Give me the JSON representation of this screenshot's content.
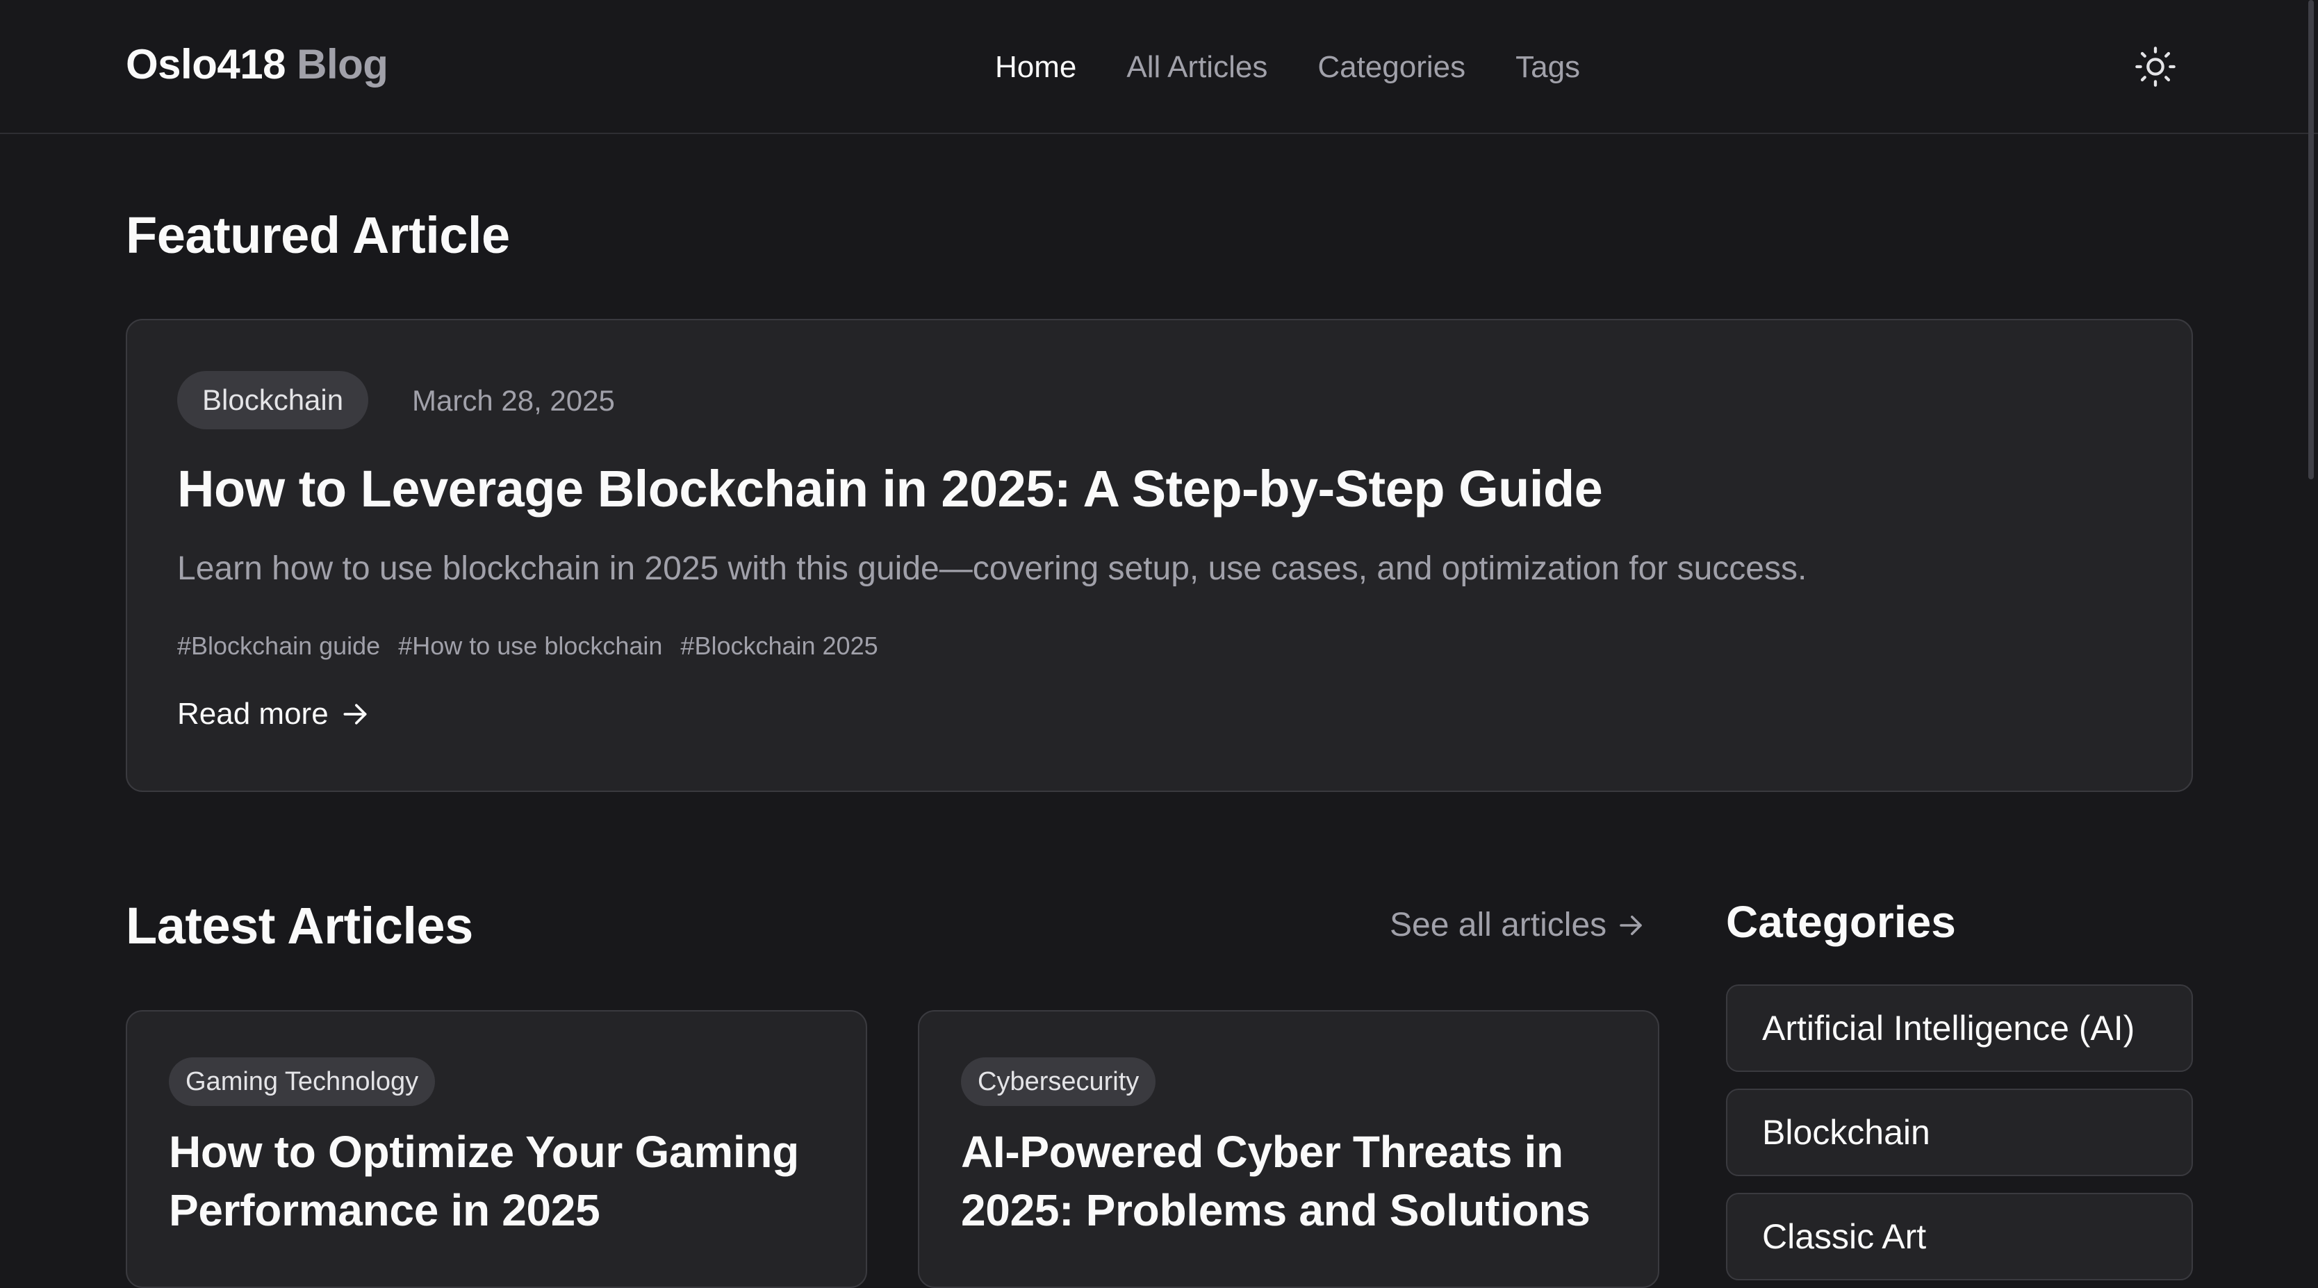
{
  "header": {
    "logo_main": "Oslo418",
    "logo_accent": "Blog",
    "nav": [
      {
        "label": "Home"
      },
      {
        "label": "All Articles"
      },
      {
        "label": "Categories"
      },
      {
        "label": "Tags"
      }
    ],
    "theme_icon": "sun-icon"
  },
  "featured": {
    "section_title": "Featured Article",
    "category": "Blockchain",
    "date": "March 28, 2025",
    "title": "How to Leverage Blockchain in 2025: A Step-by-Step Guide",
    "excerpt": "Learn how to use blockchain in 2025 with this guide—covering setup, use cases, and optimization for success.",
    "tags": [
      "#Blockchain guide",
      "#How to use blockchain",
      "#Blockchain 2025"
    ],
    "read_more": "Read more"
  },
  "latest": {
    "section_title": "Latest Articles",
    "see_all": "See all articles",
    "articles": [
      {
        "category": "Gaming Technology",
        "title": "How to Optimize Your Gaming Performance in 2025"
      },
      {
        "category": "Cybersecurity",
        "title": "AI-Powered Cyber Threats in 2025: Problems and Solutions"
      }
    ]
  },
  "sidebar": {
    "title": "Categories",
    "categories": [
      {
        "label": "Artificial Intelligence (AI)"
      },
      {
        "label": "Blockchain"
      },
      {
        "label": "Classic Art"
      }
    ]
  },
  "colors": {
    "background": "#18181b",
    "card": "#242427",
    "border": "#3a3a3f",
    "muted_text": "#a1a1aa",
    "text": "#fafafa"
  }
}
